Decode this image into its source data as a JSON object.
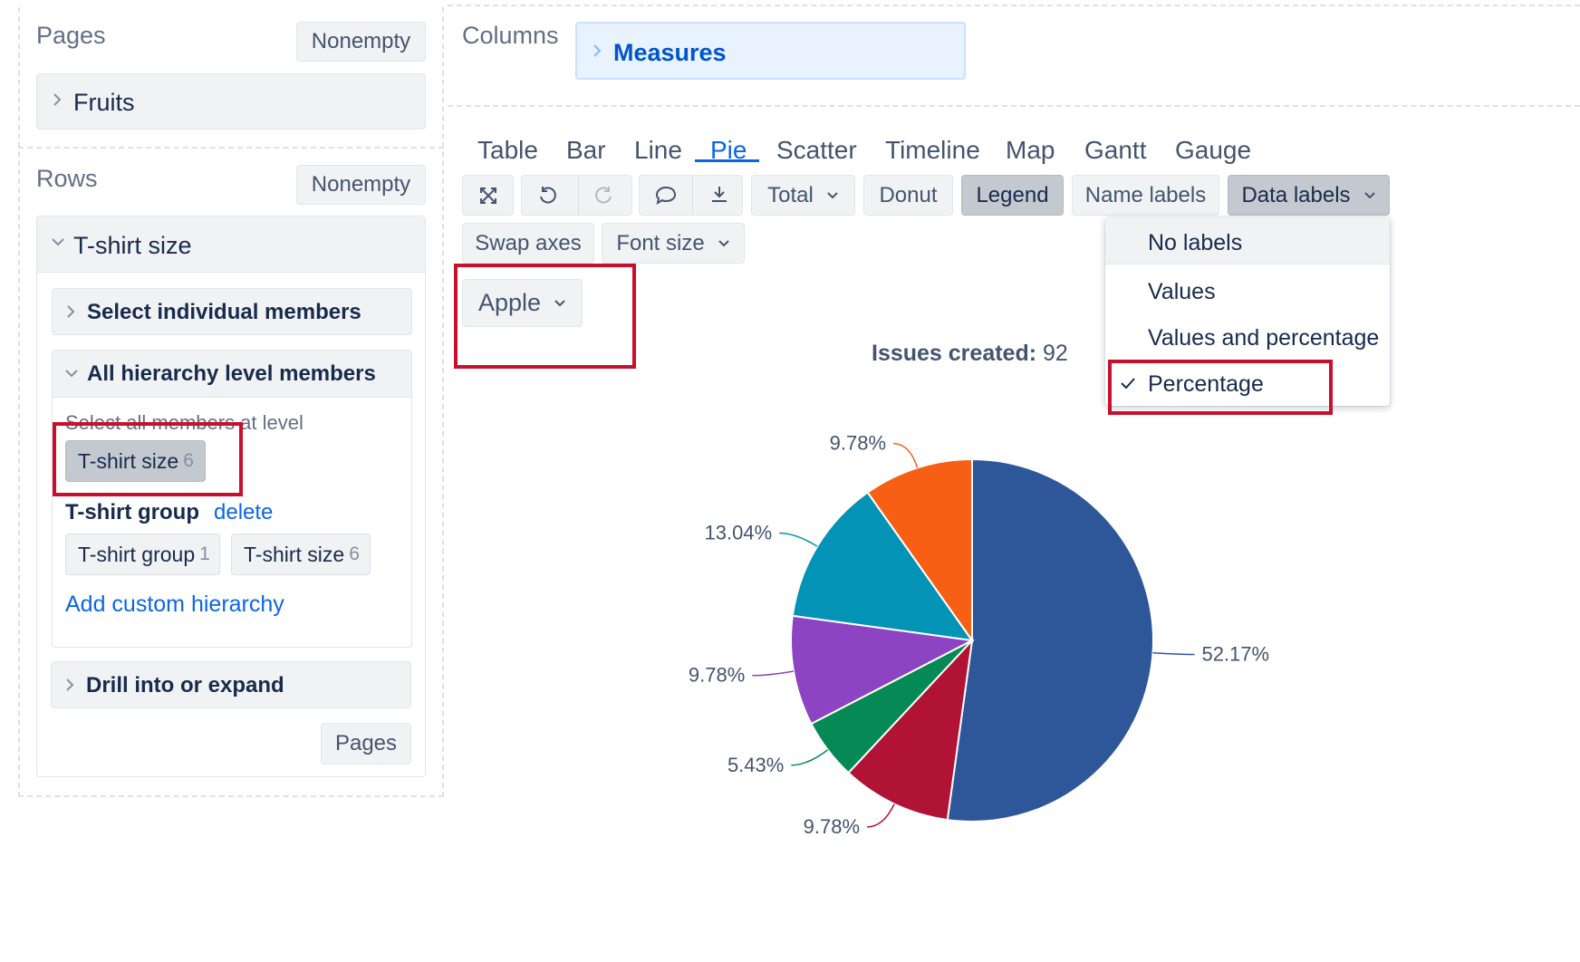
{
  "left_panel": {
    "pages": {
      "label": "Pages",
      "nonempty_label": "Nonempty",
      "dimension": "Fruits"
    },
    "rows": {
      "label": "Rows",
      "nonempty_label": "Nonempty",
      "dimension": "T-shirt size",
      "select_individual": "Select individual members",
      "all_hierarchy": "All hierarchy level members",
      "select_all_text": "Select all members at level",
      "level_chip": {
        "label": "T-shirt size",
        "count": "6"
      },
      "group_label": "T-shirt group",
      "delete_label": "delete",
      "group_chips": [
        {
          "label": "T-shirt group",
          "count": "1"
        },
        {
          "label": "T-shirt size",
          "count": "6"
        }
      ],
      "add_custom": "Add custom hierarchy",
      "drill": "Drill into or expand",
      "pages_button": "Pages"
    }
  },
  "columns": {
    "label": "Columns",
    "dimension": "Measures"
  },
  "tabs": [
    {
      "label": "Table",
      "active": false
    },
    {
      "label": "Bar",
      "active": false
    },
    {
      "label": "Line",
      "active": false
    },
    {
      "label": "Pie",
      "active": true
    },
    {
      "label": "Scatter",
      "active": false
    },
    {
      "label": "Timeline",
      "active": false
    },
    {
      "label": "Map",
      "active": false
    },
    {
      "label": "Gantt",
      "active": false
    },
    {
      "label": "Gauge",
      "active": false
    }
  ],
  "toolbar": {
    "total_label": "Total",
    "donut_label": "Donut",
    "legend_label": "Legend",
    "name_labels_label": "Name labels",
    "data_labels_label": "Data labels",
    "swap_axes_label": "Swap axes",
    "font_size_label": "Font size"
  },
  "page_selector": {
    "value": "Apple"
  },
  "data_labels_menu": {
    "items": [
      {
        "label": "No labels",
        "checked": false
      },
      {
        "label": "Values",
        "checked": false
      },
      {
        "label": "Values and percentage",
        "checked": false
      },
      {
        "label": "Percentage",
        "checked": true
      }
    ]
  },
  "chart_title": {
    "label": "Issues created:",
    "value": "92"
  },
  "chart_data": {
    "type": "pie",
    "title": "Issues created: 92",
    "total": 92,
    "slices": [
      {
        "value": 48,
        "percent_label": "52.17%",
        "color": "#2e579a"
      },
      {
        "value": 9,
        "percent_label": "9.78%",
        "color": "#b01333"
      },
      {
        "value": 5,
        "percent_label": "5.43%",
        "color": "#058a55"
      },
      {
        "value": 9,
        "percent_label": "9.78%",
        "color": "#8c44c2"
      },
      {
        "value": 12,
        "percent_label": "13.04%",
        "color": "#0393b6"
      },
      {
        "value": 9,
        "percent_label": "9.78%",
        "color": "#f75f15"
      }
    ]
  }
}
